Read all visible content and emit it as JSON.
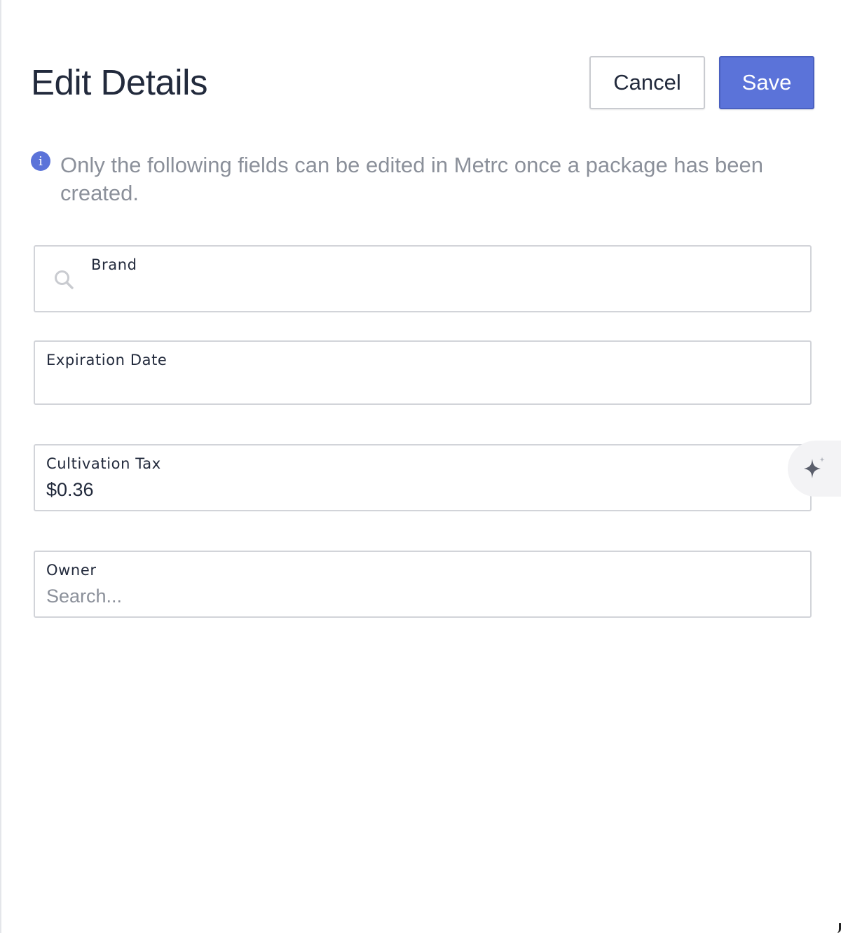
{
  "header": {
    "title": "Edit Details",
    "cancel_label": "Cancel",
    "save_label": "Save"
  },
  "info": {
    "icon": "info-icon",
    "icon_glyph": "i",
    "message": "Only the following fields can be edited in Metrc once a package has been created."
  },
  "fields": {
    "brand": {
      "label": "Brand",
      "value": "",
      "icon": "search-icon"
    },
    "expiration_date": {
      "label": "Expiration Date",
      "value": ""
    },
    "cultivation_tax": {
      "label": "Cultivation Tax",
      "value": "$0.36"
    },
    "owner": {
      "label": "Owner",
      "placeholder": "Search..."
    }
  },
  "colors": {
    "accent": "#5b73d9",
    "text": "#222a3c",
    "muted": "#8b909a",
    "border": "#d2d4d9"
  },
  "assistant": {
    "icon": "sparkle-icon"
  }
}
